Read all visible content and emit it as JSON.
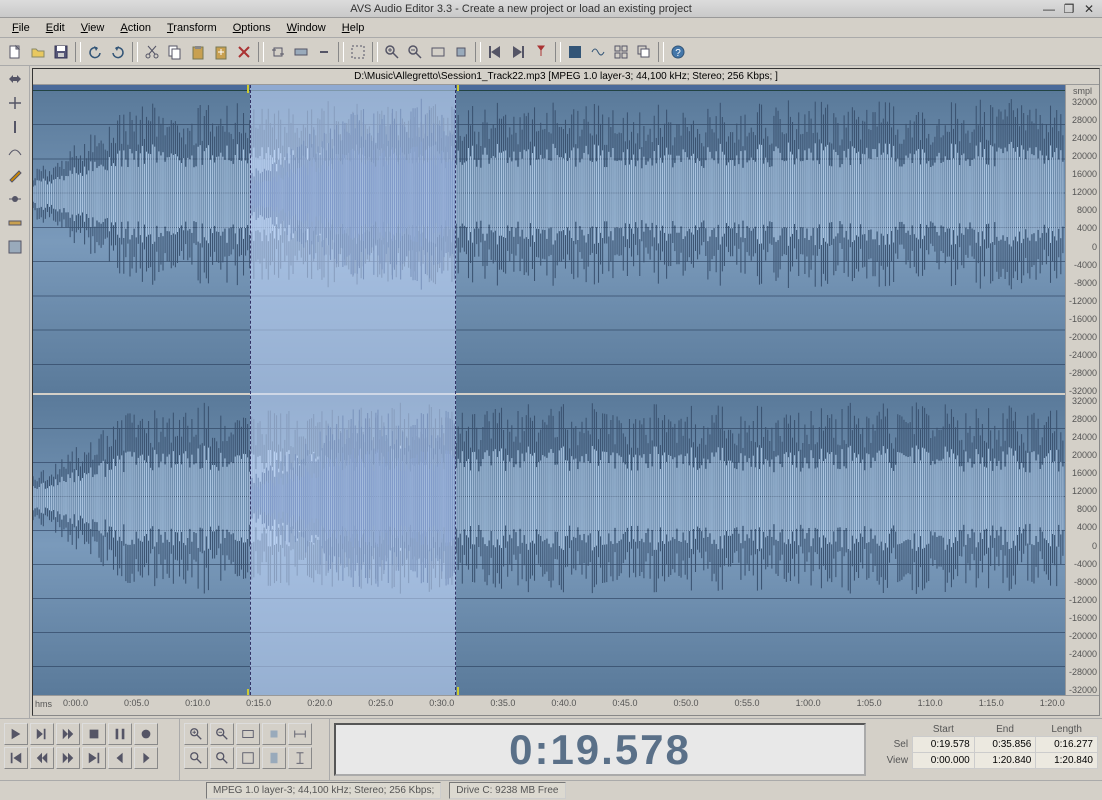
{
  "window": {
    "title": "AVS Audio Editor 3.3 - Create a new project or load an existing project"
  },
  "menu": [
    "File",
    "Edit",
    "View",
    "Action",
    "Transform",
    "Options",
    "Window",
    "Help"
  ],
  "toolbar_icons": [
    "new-file",
    "open-file",
    "save-file",
    "",
    "undo",
    "redo",
    "",
    "cut",
    "copy",
    "paste",
    "paste-mix",
    "delete",
    "",
    "crop",
    "trim",
    "silence",
    "",
    "select-all",
    "",
    "zoom-in",
    "zoom-out",
    "zoom-full",
    "zoom-selection",
    "",
    "cursor-start",
    "cursor-end",
    "marker",
    "",
    "spectral",
    "waveform",
    "window-tile",
    "window-cascade",
    "",
    "help"
  ],
  "side_icons": [
    "tool-select",
    "tool-move",
    "tool-cursor",
    "tool-envelope",
    "tool-draw",
    "tool-scrub",
    "tool-measure",
    "tool-misc"
  ],
  "file_header": "D:\\Music\\Allegretto\\Session1_Track22.mp3 [MPEG 1.0 layer-3; 44,100 kHz; Stereo; 256 Kbps; ]",
  "amplitude": {
    "unit": "smpl",
    "ticks": [
      "32000",
      "28000",
      "24000",
      "20000",
      "16000",
      "12000",
      "8000",
      "4000",
      "0",
      "-4000",
      "-8000",
      "-12000",
      "-16000",
      "-20000",
      "-24000",
      "-28000",
      "-32000"
    ]
  },
  "time_ruler": {
    "unit": "hms",
    "ticks": [
      "0:00.0",
      "0:05.0",
      "0:10.0",
      "0:15.0",
      "0:20.0",
      "0:25.0",
      "0:30.0",
      "0:35.0",
      "0:40.0",
      "0:45.0",
      "0:50.0",
      "0:55.0",
      "1:00.0",
      "1:05.0",
      "1:10.0",
      "1:15.0",
      "1:20.0"
    ]
  },
  "time_display": "0:19.578",
  "selinfo": {
    "headers": [
      "Start",
      "End",
      "Length"
    ],
    "rows": [
      {
        "label": "Sel",
        "start": "0:19.578",
        "end": "0:35.856",
        "length": "0:16.277"
      },
      {
        "label": "View",
        "start": "0:00.000",
        "end": "1:20.840",
        "length": "1:20.840"
      }
    ]
  },
  "status": {
    "format": "MPEG 1.0 layer-3; 44,100 kHz; Stereo; 256 Kbps;",
    "disk": "Drive C: 9238 MB Free"
  }
}
